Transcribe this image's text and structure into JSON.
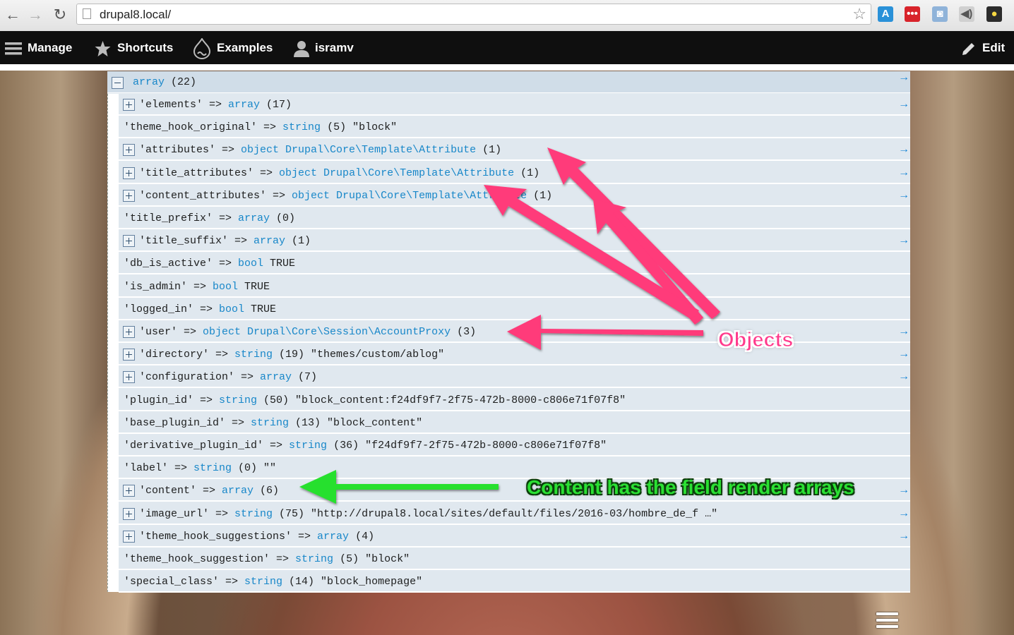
{
  "browser": {
    "url": "drupal8.local/",
    "back": "←",
    "forward": "→",
    "reload": "↻",
    "star": "☆",
    "extensions": [
      {
        "icon": "a-extension-icon",
        "glyph": "A",
        "bg": "#2a91d8",
        "fg": "#ffffff"
      },
      {
        "icon": "lastpass-icon",
        "glyph": "•••",
        "bg": "#d8232a",
        "fg": "#ffffff"
      },
      {
        "icon": "camera-icon",
        "glyph": "◙",
        "bg": "#8fb3d9",
        "fg": "#ffffff"
      },
      {
        "icon": "speaker-icon",
        "glyph": "◀)",
        "bg": "#d0d0d0",
        "fg": "#555555"
      },
      {
        "icon": "bulb-icon",
        "glyph": "●",
        "bg": "#2b2b2b",
        "fg": "#f5d742"
      }
    ]
  },
  "toolbar": {
    "manage": "Manage",
    "shortcuts": "Shortcuts",
    "examples": "Examples",
    "user": "isramv",
    "edit": "Edit"
  },
  "kint": {
    "header": {
      "type": "array",
      "rest": " (22)"
    },
    "rows": [
      {
        "expand": true,
        "key": "'elements' => ",
        "type": "array",
        "rest": " (17)"
      },
      {
        "expand": false,
        "key": "'theme_hook_original' => ",
        "type": "string",
        "rest": " (5) \"block\""
      },
      {
        "expand": true,
        "key": "'attributes' => ",
        "type": "object Drupal\\Core\\Template\\Attribute",
        "rest": " (1)"
      },
      {
        "expand": true,
        "key": "'title_attributes' => ",
        "type": "object Drupal\\Core\\Template\\Attribute",
        "rest": " (1)"
      },
      {
        "expand": true,
        "key": "'content_attributes' => ",
        "type": "object Drupal\\Core\\Template\\Attribute",
        "rest": " (1)"
      },
      {
        "expand": false,
        "key": "'title_prefix' => ",
        "type": "array",
        "rest": " (0)"
      },
      {
        "expand": true,
        "key": "'title_suffix' => ",
        "type": "array",
        "rest": " (1)"
      },
      {
        "expand": false,
        "key": "'db_is_active' => ",
        "type": "bool",
        "rest": " TRUE"
      },
      {
        "expand": false,
        "key": "'is_admin' => ",
        "type": "bool",
        "rest": " TRUE"
      },
      {
        "expand": false,
        "key": "'logged_in' => ",
        "type": "bool",
        "rest": " TRUE"
      },
      {
        "expand": true,
        "key": "'user' => ",
        "type": "object Drupal\\Core\\Session\\AccountProxy",
        "rest": " (3)"
      },
      {
        "expand": true,
        "key": "'directory' => ",
        "type": "string",
        "rest": " (19) \"themes/custom/ablog\""
      },
      {
        "expand": true,
        "key": "'configuration' => ",
        "type": "array",
        "rest": " (7)"
      },
      {
        "expand": false,
        "key": "'plugin_id' => ",
        "type": "string",
        "rest": " (50) \"block_content:f24df9f7-2f75-472b-8000-c806e71f07f8\""
      },
      {
        "expand": false,
        "key": "'base_plugin_id' => ",
        "type": "string",
        "rest": " (13) \"block_content\""
      },
      {
        "expand": false,
        "key": "'derivative_plugin_id' => ",
        "type": "string",
        "rest": " (36) \"f24df9f7-2f75-472b-8000-c806e71f07f8\""
      },
      {
        "expand": false,
        "key": "'label' => ",
        "type": "string",
        "rest": " (0) \"\""
      },
      {
        "expand": true,
        "key": "'content' => ",
        "type": "array",
        "rest": " (6)"
      },
      {
        "expand": true,
        "key": "'image_url' => ",
        "type": "string",
        "rest": " (75) \"http://drupal8.local/sites/default/files/2016-03/hombre_de_f …\""
      },
      {
        "expand": true,
        "key": "'theme_hook_suggestions' => ",
        "type": "array",
        "rest": " (4)"
      },
      {
        "expand": false,
        "key": "'theme_hook_suggestion' => ",
        "type": "string",
        "rest": " (5) \"block\""
      },
      {
        "expand": false,
        "key": "'special_class' => ",
        "type": "string",
        "rest": " (14) \"block_homepage\""
      }
    ],
    "arrow": "→"
  },
  "annotations": {
    "objects": "Objects",
    "content": "Content has the field render arrays",
    "objects_color": "#ff3a8c",
    "content_color": "#2be033"
  }
}
